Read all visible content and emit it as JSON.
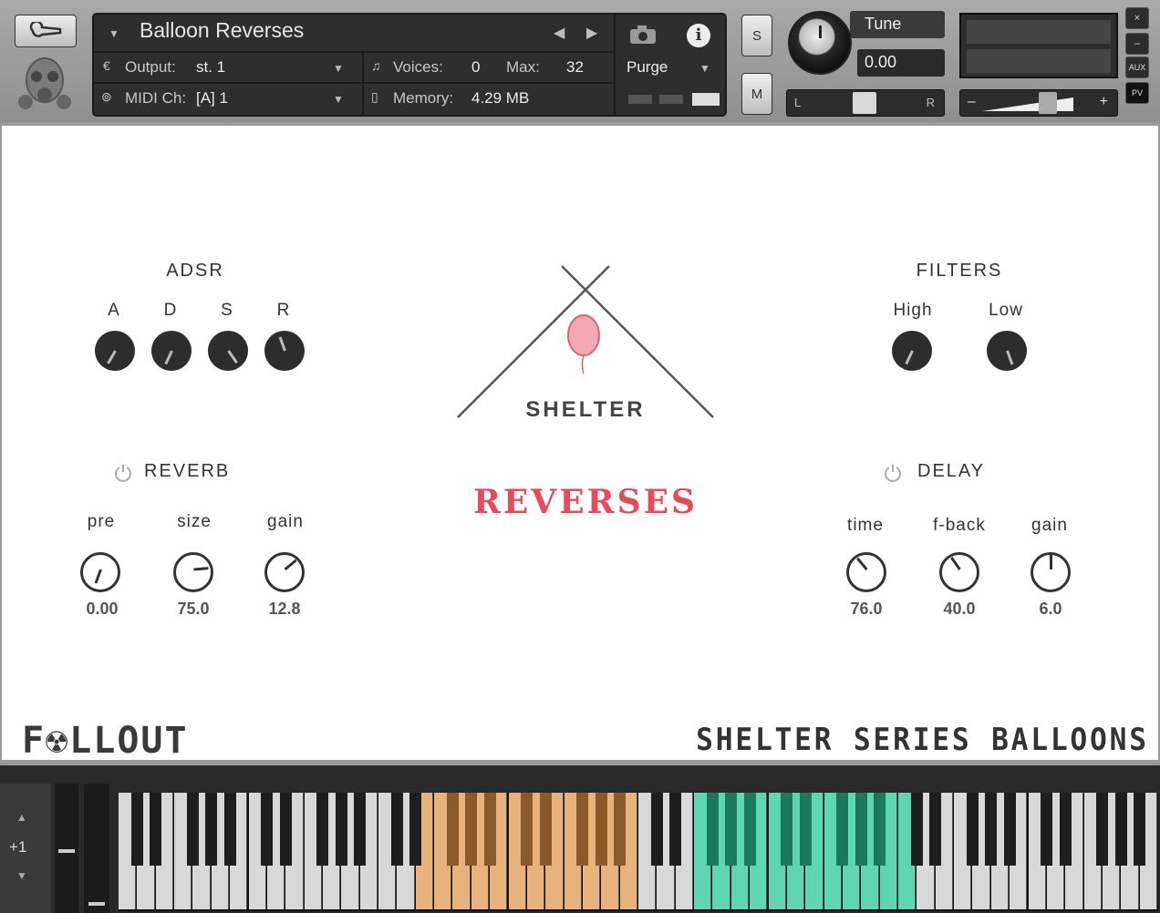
{
  "header": {
    "instrument_name": "Balloon Reverses",
    "output_label": "Output:",
    "output_value": "st. 1",
    "voices_label": "Voices:",
    "voices_value": "0",
    "max_label": "Max:",
    "max_value": "32",
    "purge_label": "Purge",
    "midi_label": "MIDI Ch:",
    "midi_value": "[A]  1",
    "memory_label": "Memory:",
    "memory_value": "4.29 MB",
    "solo_label": "S",
    "mute_label": "M",
    "tune_label": "Tune",
    "tune_value": "0.00",
    "pan_left": "L",
    "pan_right": "R",
    "vol_minus": "–",
    "vol_plus": "+",
    "close_label": "×",
    "minimize_label": "–",
    "aux_label": "AUX",
    "pv_label": "PV"
  },
  "adsr": {
    "title": "ADSR",
    "labels": [
      "A",
      "D",
      "S",
      "R"
    ]
  },
  "filters": {
    "title": "FILTERS",
    "labels": [
      "High",
      "Low"
    ]
  },
  "reverb": {
    "title": "REVERB",
    "labels": [
      "pre",
      "size",
      "gain"
    ],
    "values": [
      "0.00",
      "75.0",
      "12.8"
    ]
  },
  "delay": {
    "title": "DELAY",
    "labels": [
      "time",
      "f-back",
      "gain"
    ],
    "values": [
      "76.0",
      "40.0",
      "6.0"
    ]
  },
  "branding": {
    "shelter": "SHELTER",
    "product": "REVERSES",
    "company": "F☢LLOUT",
    "series": "SHELTER SERIES BALLOONS"
  },
  "keyboard": {
    "octave_label": "+1"
  },
  "colors": {
    "accent_red": "#e64b5a",
    "orange_zone": "#e8b27c",
    "green_zone": "#5dd6b1"
  }
}
